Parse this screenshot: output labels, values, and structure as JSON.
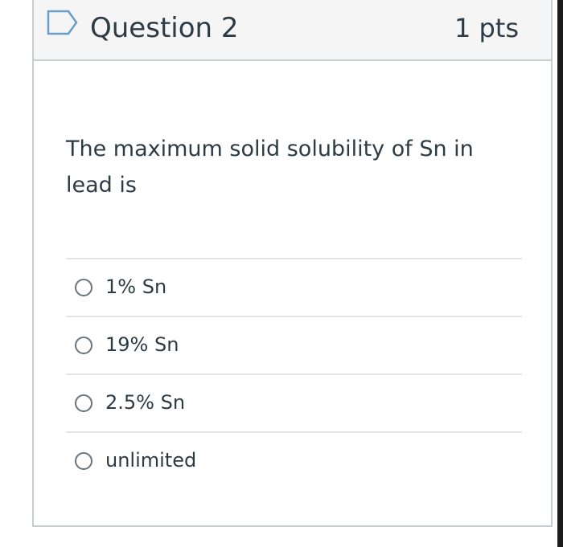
{
  "question": {
    "title": "Question 2",
    "points": "1 pts",
    "text": "The maximum solid solubility of Sn in lead is",
    "flag_icon": "bookmark-flag-icon",
    "accent_color": "#6a9ec9"
  },
  "answers": [
    {
      "label": "1% Sn",
      "selected": false
    },
    {
      "label": "19% Sn",
      "selected": false
    },
    {
      "label": "2.5% Sn",
      "selected": false
    },
    {
      "label": "unlimited",
      "selected": false
    }
  ]
}
